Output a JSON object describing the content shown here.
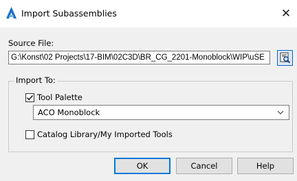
{
  "window": {
    "title": "Import Subassemblies",
    "app_icon": "autocad-civil3d-icon",
    "close_glyph": "✕"
  },
  "source": {
    "label": "Source File:",
    "path": "G:\\Konst\\02 Projects\\17-BIM\\02C3D\\BR_CG_2201-Monoblock\\WIP\\uSE",
    "browse_icon": "browse-file-icon"
  },
  "import_to": {
    "label": "Import To:",
    "tool_palette": {
      "label": "Tool Palette",
      "checked": true
    },
    "palette_select": {
      "selected": "ACO Monoblock"
    },
    "catalog": {
      "label": "Catalog Library/My Imported Tools",
      "checked": false
    }
  },
  "buttons": {
    "ok": "OK",
    "cancel": "Cancel",
    "help": "Help"
  },
  "colors": {
    "accent": "#0078d7",
    "icon_blue": "#1c6fc8"
  }
}
